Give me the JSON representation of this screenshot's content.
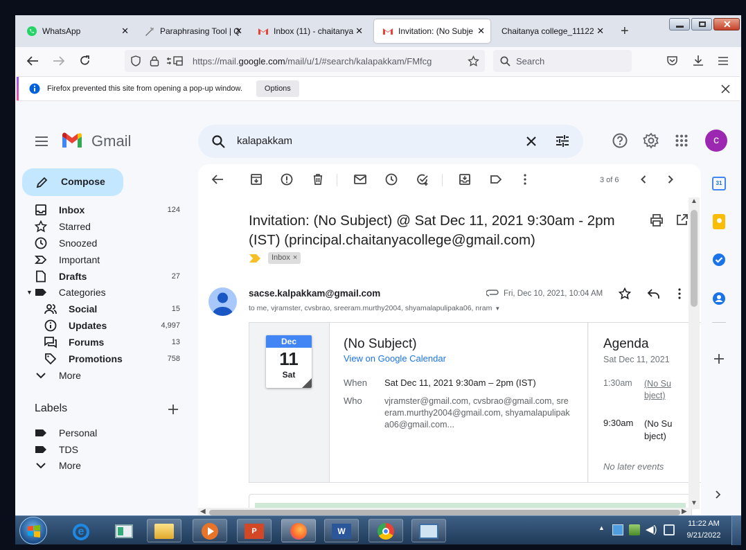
{
  "browser": {
    "tabs": [
      {
        "title": "WhatsApp",
        "active": false
      },
      {
        "title": "Paraphrasing Tool | Q",
        "active": false
      },
      {
        "title": "Inbox (11) - chaitanya",
        "active": false
      },
      {
        "title": "Invitation: (No Subje",
        "active": true
      },
      {
        "title": "Chaitanya college_11122",
        "active": false
      }
    ],
    "url_prefix": "https://mail.",
    "url_domain": "google.com",
    "url_rest": "/mail/u/1/#search/kalapakkam/FMfcg",
    "search_placeholder": "Search",
    "popup_message": "Firefox prevented this site from opening a pop-up window.",
    "popup_options": "Options"
  },
  "gmail": {
    "logo_text": "Gmail",
    "search_query": "kalapakkam",
    "avatar_letter": "c",
    "compose": "Compose",
    "nav": [
      {
        "label": "Inbox",
        "count": "124",
        "bold": true
      },
      {
        "label": "Starred",
        "count": "",
        "bold": false
      },
      {
        "label": "Snoozed",
        "count": "",
        "bold": false
      },
      {
        "label": "Important",
        "count": "",
        "bold": false
      },
      {
        "label": "Drafts",
        "count": "27",
        "bold": true
      },
      {
        "label": "Categories",
        "count": "",
        "bold": false
      },
      {
        "label": "Social",
        "count": "15",
        "bold": true
      },
      {
        "label": "Updates",
        "count": "4,997",
        "bold": true
      },
      {
        "label": "Forums",
        "count": "13",
        "bold": true
      },
      {
        "label": "Promotions",
        "count": "758",
        "bold": true
      },
      {
        "label": "More",
        "count": "",
        "bold": false
      }
    ],
    "labels_heading": "Labels",
    "labels": [
      "Personal",
      "TDS",
      "More"
    ],
    "pager": "3 of 6",
    "subject": "Invitation: (No Subject) @ Sat Dec 11, 2021 9:30am - 2pm (IST) (principal.chaitanyacollege@gmail.com)",
    "label_chip": "Inbox",
    "sender": "sacse.kalpakkam@gmail.com",
    "recipients": "to me, vjramster, cvsbrao, sreeram.murthy2004, shyamalapulipaka06, nram",
    "date": "Fri, Dec 10, 2021, 10:04 AM",
    "event": {
      "month": "Dec",
      "day": "11",
      "weekday": "Sat",
      "title": "(No Subject)",
      "calendar_link": "View on Google Calendar",
      "when_label": "When",
      "when": "Sat Dec 11, 2021 9:30am – 2pm (IST)",
      "who_label": "Who",
      "who": "vjramster@gmail.com, cvsbrao@gmail.com, sreeram.murthy2004@gmail.com, shyamalapulipaka06@gmail.com..."
    },
    "agenda": {
      "title": "Agenda",
      "date": "Sat Dec 11, 2021",
      "items": [
        {
          "time": "1:30am",
          "title": "(No Subject)"
        },
        {
          "time": "9:30am",
          "title": "(No Subject)"
        }
      ],
      "footer": "No later events"
    }
  },
  "taskbar": {
    "time": "11:22 AM",
    "date": "9/21/2022"
  }
}
